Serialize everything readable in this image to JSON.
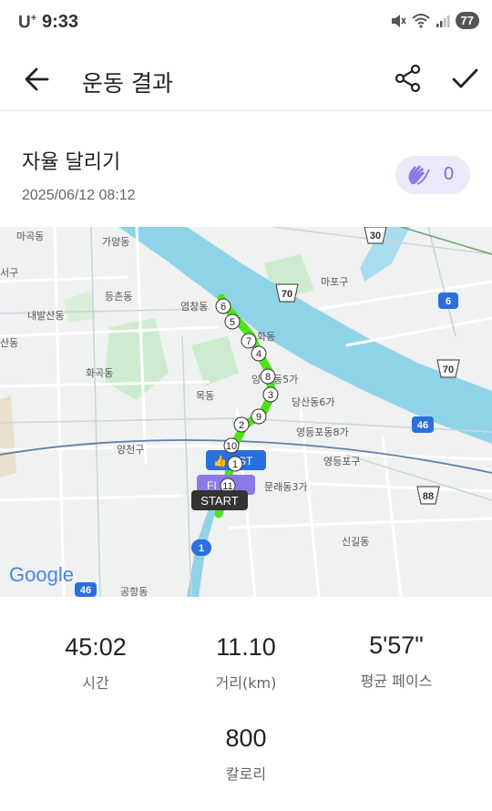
{
  "status_bar": {
    "carrier": "U",
    "carrier_sup": "+",
    "time": "9:33",
    "battery": "77"
  },
  "app_bar": {
    "title": "운동 결과",
    "icons": [
      "back-arrow-icon",
      "share-icon",
      "check-icon"
    ]
  },
  "run": {
    "title": "자율 달리기",
    "date": "2025/06/12 08:12",
    "like_count": "0"
  },
  "map": {
    "labels": {
      "macho": "마곡동",
      "gayang": "가양동",
      "seoul": "서구",
      "mapo": "마포구",
      "deungchon": "등촌동",
      "naebalsan": "내발산동",
      "yeomchang": "염창동",
      "hwagok": "화곡동",
      "sandong": "산동",
      "hwadong": "화동",
      "dang5": "동5가",
      "dangsan6": "당산동6가",
      "mok": "목동",
      "ying": "잉",
      "yangcheon": "양천구",
      "yeongdeungpo8": "영등포동8가",
      "yeongdeungpogu": "영등포구",
      "mullae3": "문래동3가",
      "singil": "신길동",
      "gonghang": "공항동"
    },
    "road_shields": [
      "30",
      "70",
      "6",
      "70",
      "46",
      "88",
      "1",
      "46"
    ],
    "markers": [
      "1",
      "2",
      "3",
      "4",
      "5",
      "6",
      "7",
      "8",
      "9",
      "10",
      "11"
    ],
    "start_label": "START",
    "best_label": "ST",
    "worst_label": "FI",
    "logo": "Google",
    "colors": {
      "route": "#4fe21a",
      "river": "#8fd3e8",
      "park": "#cdeccf",
      "badge_blue": "#2b6fdc",
      "badge_purple": "#8a7be8",
      "start_bg": "#333333"
    }
  },
  "stats": {
    "time": {
      "value": "45:02",
      "label": "시간"
    },
    "distance": {
      "value": "11.10",
      "label": "거리(km)"
    },
    "pace": {
      "value": "5'57\"",
      "label": "평균 페이스"
    },
    "calories": {
      "value": "800",
      "label": "칼로리"
    }
  }
}
